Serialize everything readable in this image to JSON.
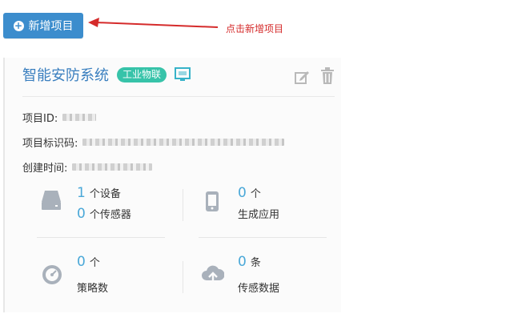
{
  "toolbar": {
    "add_project_label": "新增项目"
  },
  "annotation": {
    "text": "点击新增项目",
    "color": "#d52b2b"
  },
  "project": {
    "name": "智能安防系统",
    "tag": "工业物联",
    "fields": {
      "id_label": "项目ID:",
      "code_label": "项目标识码:",
      "created_label": "创建时间:"
    },
    "stats": {
      "devices": {
        "count": "1",
        "unit": "个设备"
      },
      "sensors": {
        "count": "0",
        "unit": "个传感器"
      },
      "apps": {
        "count": "0",
        "unit": "个",
        "label": "生成应用"
      },
      "policies": {
        "count": "0",
        "unit": "个",
        "label": "策略数"
      },
      "data": {
        "count": "0",
        "unit": "条",
        "label": "传感数据"
      }
    }
  },
  "colors": {
    "primary": "#3c8dcd",
    "tag": "#37c3a9",
    "number": "#4aa8d8",
    "title": "#3a7fbf"
  },
  "icons": [
    "plus-circle-icon",
    "arrow-icon",
    "monitor-icon",
    "edit-icon",
    "trash-icon",
    "drive-icon",
    "phone-icon",
    "gauge-icon",
    "cloud-upload-icon"
  ]
}
